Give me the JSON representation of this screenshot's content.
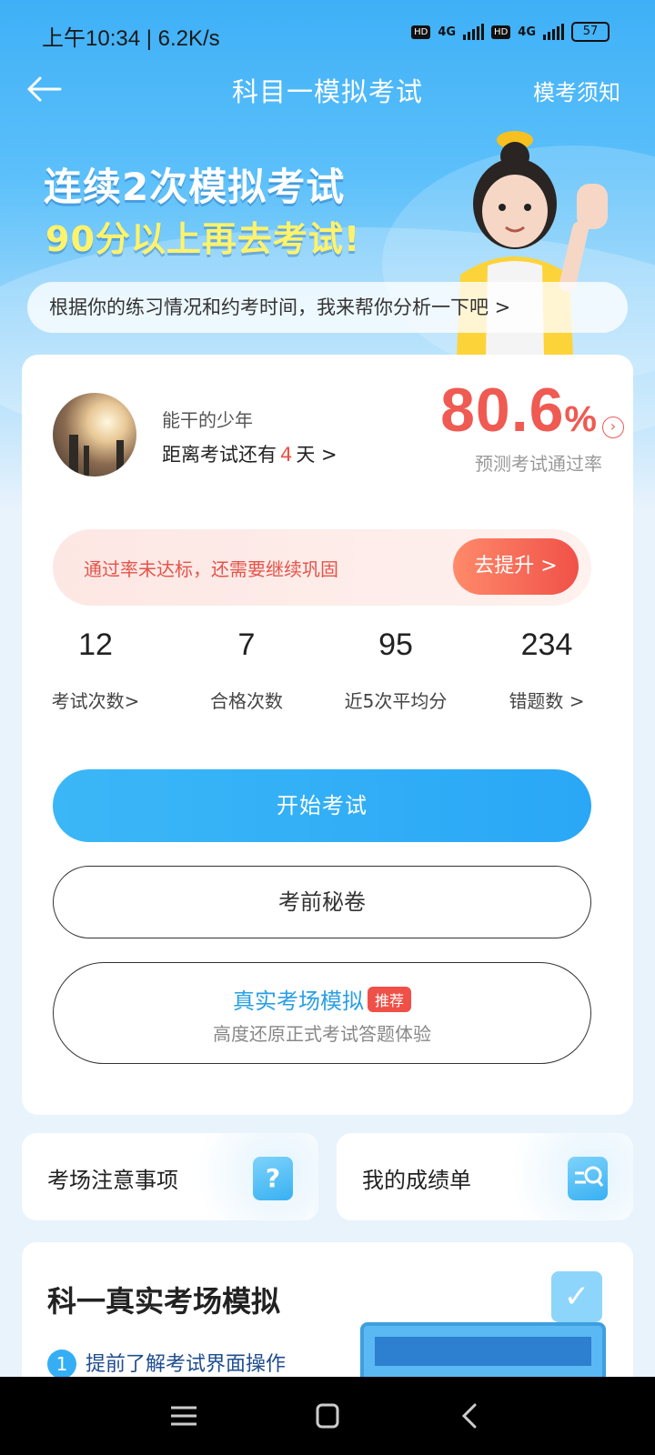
{
  "status": {
    "time": "上午10:34 | 6.2K/s",
    "network1": "4G",
    "network2": "4G",
    "hd": "HD",
    "battery": "57"
  },
  "nav": {
    "title": "科目一模拟考试",
    "right_link": "模考须知"
  },
  "banner": {
    "line1": "连续2次模拟考试",
    "line2": "90分以上再去考试!",
    "tip": "根据你的练习情况和约考时间，我来帮你分析一下吧 >"
  },
  "profile": {
    "name": "能干的少年",
    "countdown_prefix": "距离考试还有",
    "days": "4",
    "countdown_suffix": "天 >"
  },
  "pass_rate": {
    "value": "80.6",
    "unit": "%",
    "label": "预测考试通过率"
  },
  "warning": {
    "text": "通过率未达标，还需要继续巩固",
    "button": "去提升 >"
  },
  "stats": [
    {
      "value": "12",
      "label": "考试次数>"
    },
    {
      "value": "7",
      "label": "合格次数"
    },
    {
      "value": "95",
      "label": "近5次平均分"
    },
    {
      "value": "234",
      "label": "错题数 >"
    }
  ],
  "actions": {
    "start": "开始考试",
    "secret": "考前秘卷",
    "sim_title": "真实考场模拟",
    "sim_badge": "推荐",
    "sim_subtitle": "高度还原正式考试答题体验"
  },
  "cards": {
    "notice": "考场注意事项",
    "report": "我的成绩单"
  },
  "section": {
    "title": "科一真实考场模拟",
    "step_num": "1",
    "step_text": "提前了解考试界面操作"
  },
  "colors": {
    "accent": "#2aa7f6",
    "danger": "#ef5a52",
    "highlight": "#fff36b"
  }
}
